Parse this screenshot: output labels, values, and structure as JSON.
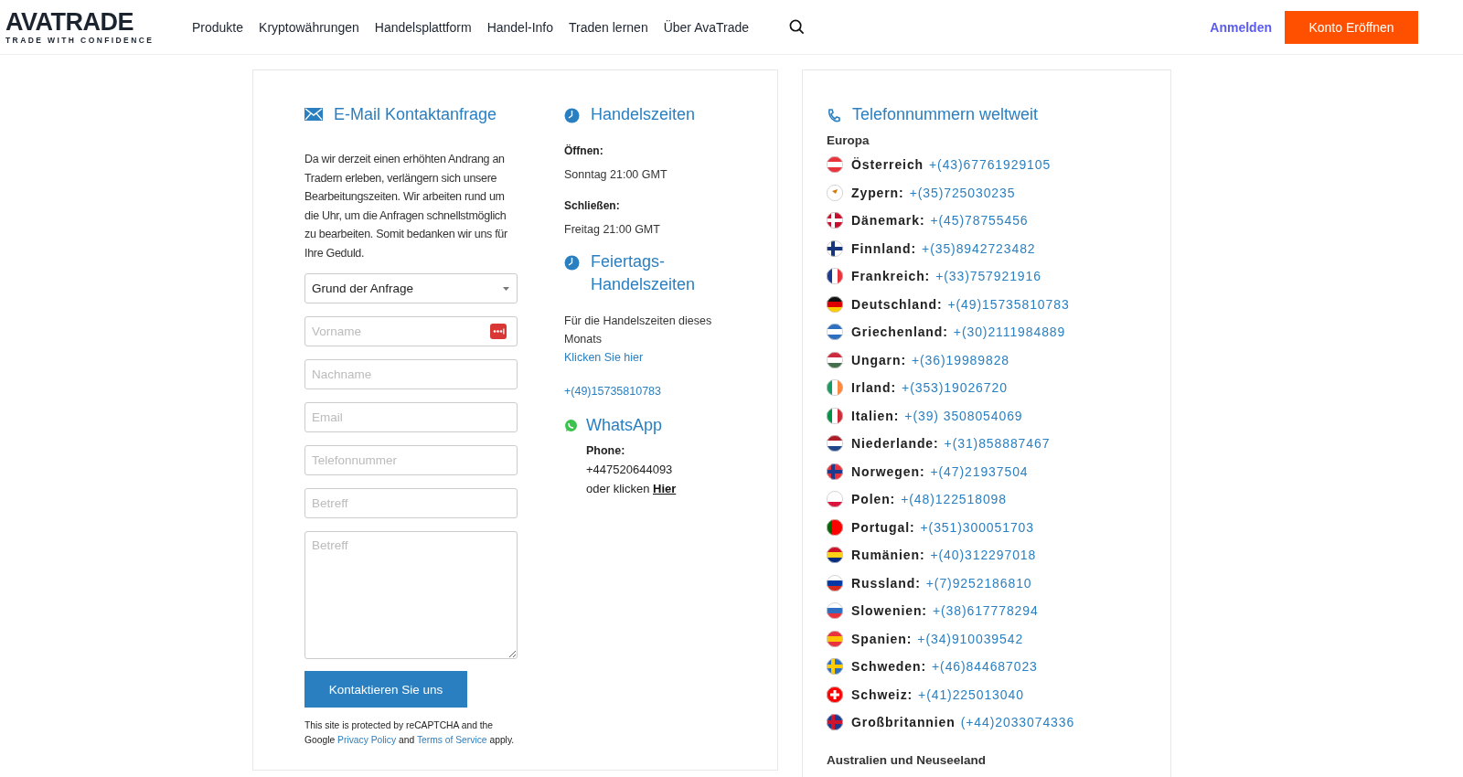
{
  "header": {
    "logo": "AVATRADE",
    "tagline": "TRADE WITH CONFIDENCE",
    "nav": [
      "Produkte",
      "Kryptowährungen",
      "Handelsplattform",
      "Handel-Info",
      "Traden lernen",
      "Über AvaTrade"
    ],
    "login": "Anmelden",
    "signup": "Konto Eröffnen"
  },
  "contact_form": {
    "title": "E-Mail Kontaktanfrage",
    "intro": "Da wir derzeit einen erhöhten Andrang an Tradern erleben, verlängern sich unsere Bearbeitungszeiten. Wir arbeiten rund um die Uhr, um die Anfragen schnellstmöglich zu bearbeiten. Somit bedanken wir uns für Ihre Geduld.",
    "fields": [
      {
        "kind": "select",
        "value": "Grund der Anfrage"
      },
      {
        "kind": "input",
        "placeholder": "Vorname",
        "autofill_badge": true
      },
      {
        "kind": "input",
        "placeholder": "Nachname",
        "autofill_badge": false
      },
      {
        "kind": "input",
        "placeholder": "Email",
        "autofill_badge": false
      },
      {
        "kind": "input",
        "placeholder": "Telefonnummer",
        "autofill_badge": false
      },
      {
        "kind": "input",
        "placeholder": "Betreff",
        "autofill_badge": false
      },
      {
        "kind": "textarea",
        "placeholder": "Betreff"
      }
    ],
    "submit": "Kontaktieren Sie uns",
    "recaptcha": {
      "before": "This site is protected by reCAPTCHA and the Google",
      "privacy_link": "Privacy Policy",
      "middle": "and",
      "terms_link": "Terms of Service",
      "after": "apply."
    }
  },
  "trading_hours": {
    "title": "Handelszeiten",
    "open_label": "Öffnen:",
    "open_value": "Sonntag 21:00 GMT",
    "close_label": "Schließen:",
    "close_value": "Freitag 21:00 GMT"
  },
  "holiday_hours": {
    "title": "Feiertags-Handelszeiten",
    "text": "Für die Handelszeiten dieses Monats",
    "link": "Klicken Sie hier",
    "phone": "+(49)15735810783"
  },
  "whatsapp": {
    "title": "WhatsApp",
    "phone_label": "Phone:",
    "phone": "+447520644093",
    "text": "oder klicken",
    "link": "Hier"
  },
  "phones": {
    "title": "Telefonnummern weltweit",
    "regions": [
      {
        "name": "Europa",
        "countries": [
          {
            "name": "Österreich",
            "number": "+(43)67761929105"
          },
          {
            "name": "Zypern:",
            "number": "+(35)725030235"
          },
          {
            "name": "Dänemark:",
            "number": "+(45)78755456"
          },
          {
            "name": "Finnland:",
            "number": "+(35)8942723482"
          },
          {
            "name": "Frankreich:",
            "number": "+(33)757921916"
          },
          {
            "name": "Deutschland:",
            "number": "+(49)15735810783"
          },
          {
            "name": "Griechenland:",
            "number": "+(30)2111984889"
          },
          {
            "name": "Ungarn:",
            "number": "+(36)19989828"
          },
          {
            "name": "Irland:",
            "number": "+(353)19026720"
          },
          {
            "name": "Italien:",
            "number": "+(39) 3508054069"
          },
          {
            "name": "Niederlande:",
            "number": "+(31)858887467"
          },
          {
            "name": "Norwegen:",
            "number": "+(47)21937504"
          },
          {
            "name": "Polen:",
            "number": "+(48)122518098"
          },
          {
            "name": "Portugal:",
            "number": "+(351)300051703"
          },
          {
            "name": "Rumänien:",
            "number": "+(40)312297018"
          },
          {
            "name": "Russland:",
            "number": "+(7)9252186810"
          },
          {
            "name": "Slowenien:",
            "number": "+(38)617778294"
          },
          {
            "name": "Spanien:",
            "number": "+(34)910039542"
          },
          {
            "name": "Schweden:",
            "number": "+(46)844687023"
          },
          {
            "name": "Schweiz:",
            "number": "+(41)225013040"
          },
          {
            "name": "Großbritannien",
            "number": "(+44)2033074336"
          }
        ]
      },
      {
        "name": "Australien und Neuseeland"
      }
    ]
  }
}
